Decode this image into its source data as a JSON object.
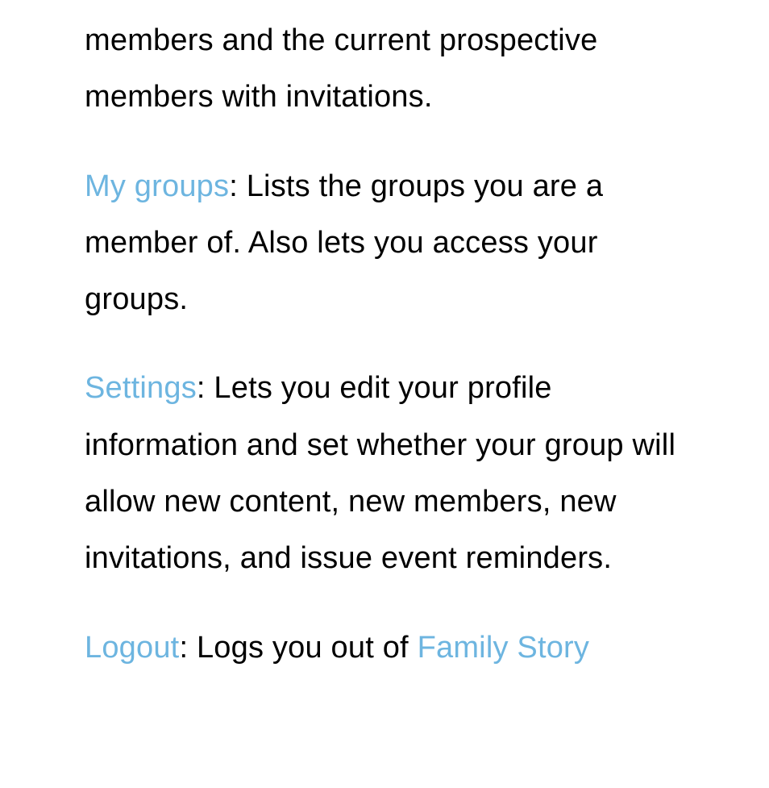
{
  "paragraphs": {
    "p0": {
      "text": "members and the current prospective members with invitations."
    },
    "p1": {
      "link": "My groups",
      "text": ": Lists the groups you are a member of. Also lets you access your groups."
    },
    "p2": {
      "link": "Settings",
      "text": ": Lets you edit your profile information and set whether your group will allow new content, new members, new invitations, and issue event reminders."
    },
    "p3": {
      "link": "Logout",
      "textBefore": ": Logs you out of ",
      "link2": "Family Story"
    }
  }
}
